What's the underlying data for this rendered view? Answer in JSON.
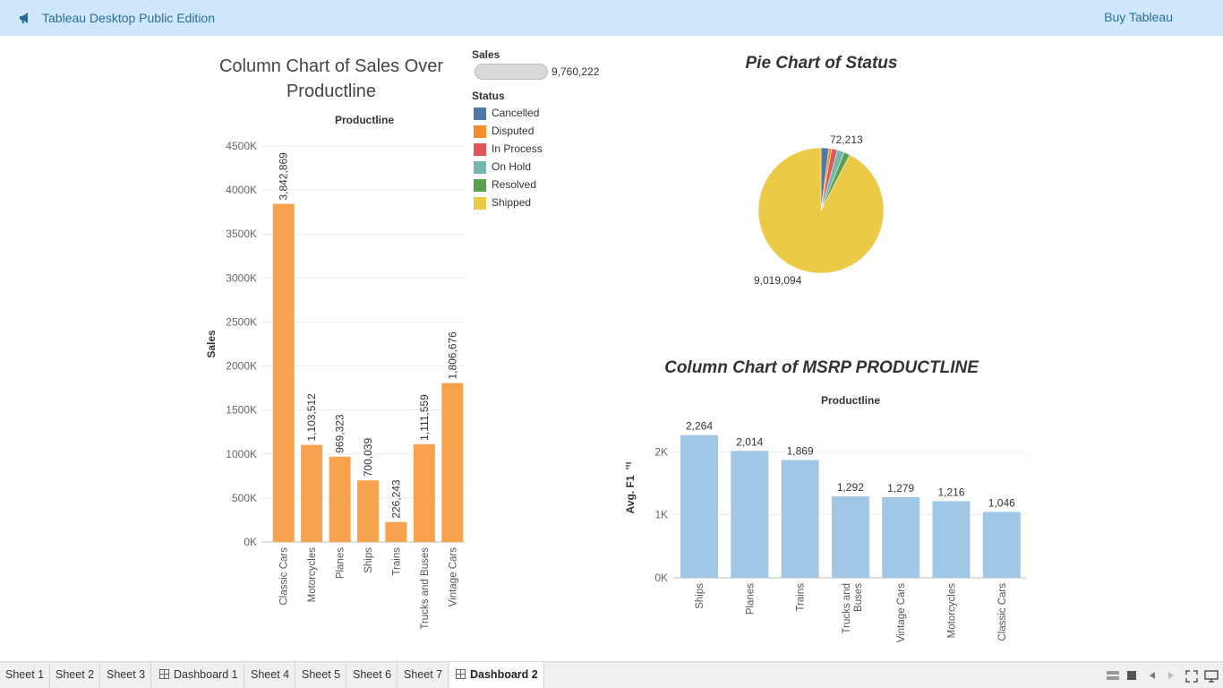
{
  "header": {
    "app_title": "Tableau Desktop Public Edition",
    "buy_label": "Buy Tableau",
    "icon": "megaphone-icon"
  },
  "sales_chart": {
    "title_line1": "Column Chart of Sales Over",
    "title_line2": "Productline",
    "column_header": "Productline",
    "chart_data": {
      "type": "bar",
      "title": "Column Chart of Sales Over Productline",
      "xlabel": "Productline",
      "ylabel": "Sales",
      "categories": [
        "Classic Cars",
        "Motorcycles",
        "Planes",
        "Ships",
        "Trains",
        "Trucks and Buses",
        "Vintage Cars"
      ],
      "values": [
        3842869,
        1103512,
        969323,
        700039,
        226243,
        1111559,
        1806676
      ],
      "value_labels": [
        "3,842,869",
        "1,103,512",
        "969,323",
        "700,039",
        "226,243",
        "1,111,559",
        "1,806,676"
      ],
      "y_ticks": [
        "0K",
        "500K",
        "1000K",
        "1500K",
        "2000K",
        "2500K",
        "3000K",
        "3500K",
        "4000K",
        "4500K"
      ],
      "ylim": [
        0,
        4500000
      ],
      "color": "#f7a24e",
      "grid": true
    }
  },
  "legend": {
    "size_title": "Sales",
    "size_value": "9,760,222",
    "status_title": "Status",
    "items": [
      {
        "label": "Cancelled",
        "color": "#4e79a7"
      },
      {
        "label": "Disputed",
        "color": "#f28e2b"
      },
      {
        "label": "In Process",
        "color": "#e15759"
      },
      {
        "label": "On Hold",
        "color": "#76b7b2"
      },
      {
        "label": "Resolved",
        "color": "#59a14f"
      },
      {
        "label": "Shipped",
        "color": "#edc948"
      }
    ]
  },
  "pie_chart": {
    "title": "Pie Chart of Status",
    "chart_data": {
      "type": "pie",
      "title": "Pie Chart of Status",
      "labels": [
        "Cancelled",
        "Disputed",
        "In Process",
        "On Hold",
        "Resolved",
        "Shipped"
      ],
      "values": [
        194487,
        72213,
        144730,
        178947,
        150751,
        9019094
      ],
      "colors": [
        "#4e79a7",
        "#f28e2b",
        "#e15759",
        "#76b7b2",
        "#59a14f",
        "#edc948"
      ],
      "shown_labels": {
        "top": "72,213",
        "bottom": "9,019,094"
      }
    }
  },
  "msrp_chart": {
    "title": "Column Chart of MSRP PRODUCTLINE",
    "column_header": "Productline",
    "y_label": "Avg. F1",
    "chart_data": {
      "type": "bar",
      "title": "Column Chart of MSRP PRODUCTLINE",
      "xlabel": "Productline",
      "ylabel": "Avg. F1",
      "categories": [
        "Ships",
        "Planes",
        "Trains",
        "Trucks and Buses",
        "Vintage Cars",
        "Motorcycles",
        "Classic Cars"
      ],
      "values": [
        2264,
        2014,
        1869,
        1292,
        1279,
        1216,
        1046
      ],
      "value_labels": [
        "2,264",
        "2,014",
        "1,869",
        "1,292",
        "1,279",
        "1,216",
        "1,046"
      ],
      "y_ticks": [
        "0K",
        "1K",
        "2K"
      ],
      "ylim": [
        0,
        2700
      ],
      "color": "#a0c8e6",
      "grid": true
    }
  },
  "tabs": [
    {
      "label": "Sheet 1",
      "type": "sheet",
      "active": false
    },
    {
      "label": "Sheet 2",
      "type": "sheet",
      "active": false
    },
    {
      "label": "Sheet 3",
      "type": "sheet",
      "active": false
    },
    {
      "label": "Dashboard 1",
      "type": "dashboard",
      "active": false
    },
    {
      "label": "Sheet 4",
      "type": "sheet",
      "active": false
    },
    {
      "label": "Sheet 5",
      "type": "sheet",
      "active": false
    },
    {
      "label": "Sheet 6",
      "type": "sheet",
      "active": false
    },
    {
      "label": "Sheet 7",
      "type": "sheet",
      "active": false
    },
    {
      "label": "Dashboard 2",
      "type": "dashboard",
      "active": true
    }
  ],
  "status_bar_icons": [
    "filmstrip-view-icon",
    "stop-icon",
    "previous-icon",
    "next-icon",
    "fullscreen-icon",
    "present-icon"
  ]
}
